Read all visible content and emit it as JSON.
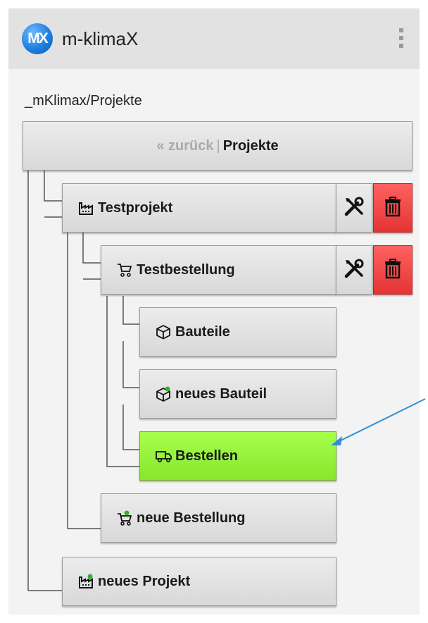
{
  "app": {
    "title": "m-klimaX",
    "logo_text": "MX"
  },
  "breadcrumb": "_mKlimax/Projekte",
  "header_button": {
    "back_label": "« zurück",
    "separator": "|",
    "current_label": "Projekte"
  },
  "tree": {
    "testprojekt": "Testprojekt",
    "testbestellung": "Testbestellung",
    "bauteile": "Bauteile",
    "neues_bauteil": "neues Bauteil",
    "bestellen": "Bestellen",
    "neue_bestellung": "neue Bestellung",
    "neues_projekt": "neues Projekt"
  },
  "icons": {
    "project": "factory-icon",
    "order": "cart-icon",
    "part": "cube-icon",
    "deliver": "truck-icon",
    "edit": "tools-icon",
    "delete": "trash-icon"
  },
  "colors": {
    "appbar": "#e2e2e2",
    "delete_button": "#e43434",
    "active_item": "#86e62c",
    "logo": "#1f7fe0",
    "annotation_arrow": "#2e8fd8"
  }
}
